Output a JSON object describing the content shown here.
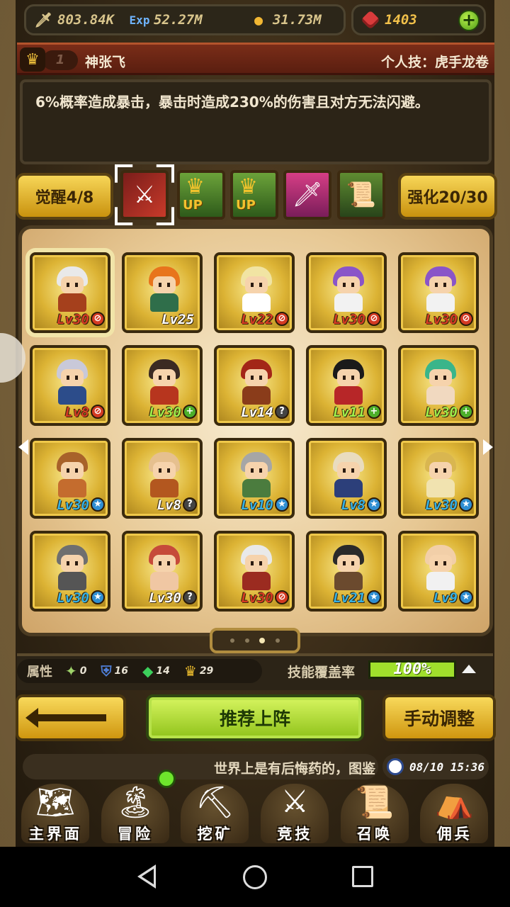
{
  "resources": {
    "attack": {
      "icon": "sword-icon",
      "value": "803.84K"
    },
    "exp": {
      "icon": "exp-icon",
      "value": "52.27M"
    },
    "gold": {
      "icon": "gold-coin-icon",
      "value": "31.73M"
    },
    "gems": {
      "icon": "ruby-icon",
      "value": "1403"
    }
  },
  "hero": {
    "rank": "1",
    "name": "神张飞",
    "skill_title": "个人技：虎手龙卷",
    "description": "6%概率造成暴击，暴击时造成230%的伤害且对方无法闪避。"
  },
  "awaken": {
    "label": "觉醒4/8"
  },
  "strengthen": {
    "label": "强化20/30"
  },
  "skill_slots": [
    {
      "name": "crossed-blades",
      "selected": true
    },
    {
      "name": "crown-up",
      "label": "UP"
    },
    {
      "name": "crown-up",
      "label": "UP"
    },
    {
      "name": "purple-sword"
    },
    {
      "name": "scroll"
    }
  ],
  "heroes": [
    {
      "level": "Lv30",
      "lv_color": "red",
      "mark": "rem",
      "hair": "#e9e9e9",
      "body": "#a5401c",
      "selected": true
    },
    {
      "level": "Lv25",
      "lv_color": "white",
      "mark": "",
      "hair": "#e8741c",
      "body": "#2f6e4a"
    },
    {
      "level": "Lv22",
      "lv_color": "red",
      "mark": "rem",
      "hair": "#f1e4a3",
      "body": "#ffffff"
    },
    {
      "level": "Lv30",
      "lv_color": "red",
      "mark": "rem",
      "hair": "#8a55c8",
      "body": "#f2f2f2"
    },
    {
      "level": "Lv30",
      "lv_color": "red",
      "mark": "rem",
      "hair": "#8a55c8",
      "body": "#f2f2f2"
    },
    {
      "level": "Lv8",
      "lv_color": "red",
      "mark": "rem",
      "hair": "#c9c9d9",
      "body": "#2c4c8a"
    },
    {
      "level": "Lv30",
      "lv_color": "green",
      "mark": "add",
      "hair": "#3b2a22",
      "body": "#b7351e"
    },
    {
      "level": "Lv14",
      "lv_color": "white",
      "mark": "unk",
      "hair": "#a32618",
      "body": "#8a3c1a"
    },
    {
      "level": "Lv11",
      "lv_color": "green",
      "mark": "add",
      "hair": "#1a1a1a",
      "body": "#b72628"
    },
    {
      "level": "Lv30",
      "lv_color": "green",
      "mark": "add",
      "hair": "#3ab58a",
      "body": "#f1d9c0"
    },
    {
      "level": "Lv30",
      "lv_color": "blue",
      "mark": "star",
      "hair": "#a8622a",
      "body": "#c46c2e"
    },
    {
      "level": "Lv8",
      "lv_color": "white",
      "mark": "unk",
      "hair": "#e6c08f",
      "body": "#b3571f"
    },
    {
      "level": "Lv10",
      "lv_color": "blue",
      "mark": "star",
      "hair": "#a6a6a6",
      "body": "#4b7c3e"
    },
    {
      "level": "Lv8",
      "lv_color": "blue",
      "mark": "star",
      "hair": "#e9dcbf",
      "body": "#2c3f7a"
    },
    {
      "level": "Lv30",
      "lv_color": "blue",
      "mark": "star",
      "hair": "#d9b650",
      "body": "#f1e3b0"
    },
    {
      "level": "Lv30",
      "lv_color": "blue",
      "mark": "star",
      "hair": "#6f6f6f",
      "body": "#555555"
    },
    {
      "level": "Lv30",
      "lv_color": "white",
      "mark": "unk",
      "hair": "#c64a3a",
      "body": "#f0c7a3"
    },
    {
      "level": "Lv30",
      "lv_color": "red",
      "mark": "rem",
      "hair": "#e9e9e9",
      "body": "#9b2b20"
    },
    {
      "level": "Lv21",
      "lv_color": "blue",
      "mark": "star",
      "hair": "#2a2a2a",
      "body": "#6b4a2e"
    },
    {
      "level": "Lv9",
      "lv_color": "blue",
      "mark": "star",
      "hair": "#f2cfa8",
      "body": "#f1f1f1"
    }
  ],
  "pager": {
    "count": 4,
    "active": 2
  },
  "attributes": {
    "label": "属性",
    "items": [
      {
        "icon": "wind-icon",
        "value": "0"
      },
      {
        "icon": "shield-icon",
        "value": "16"
      },
      {
        "icon": "gem-icon",
        "value": "14"
      },
      {
        "icon": "crown-icon",
        "value": "29"
      }
    ]
  },
  "coverage": {
    "label": "技能覆盖率",
    "value": "100%",
    "fraction": 1.0
  },
  "buttons": {
    "recommend": "推荐上阵",
    "manual": "手动调整"
  },
  "ticker": {
    "text": "世界上是有后悔药的，图鉴"
  },
  "clock": {
    "text": "08/10 15:36"
  },
  "nav": [
    {
      "label": "主界面",
      "icon": "map-scroll-icon",
      "glyph": "🗺"
    },
    {
      "label": "冒险",
      "icon": "island-icon",
      "glyph": "🏝"
    },
    {
      "label": "挖矿",
      "icon": "pickaxe-icon",
      "glyph": "⛏"
    },
    {
      "label": "竞技",
      "icon": "crossed-swords-icon",
      "glyph": "⚔"
    },
    {
      "label": "召唤",
      "icon": "summon-scroll-icon",
      "glyph": "📜"
    },
    {
      "label": "佣兵",
      "icon": "tent-icon",
      "glyph": "⛺"
    }
  ]
}
